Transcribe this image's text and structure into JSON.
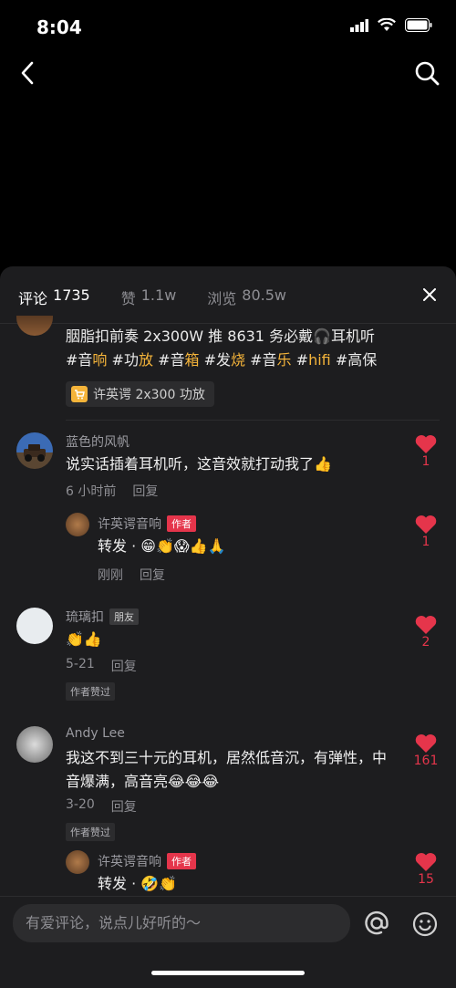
{
  "status": {
    "time": "8:04"
  },
  "header": {
    "tabs": [
      {
        "label": "评论",
        "count": "1735"
      },
      {
        "label": "赞",
        "count": "1.1w"
      },
      {
        "label": "浏览",
        "count": "80.5w"
      }
    ]
  },
  "post": {
    "line1": "胭脂扣前奏 2x300W 推 8631 务必戴🎧耳机听",
    "tags": [
      {
        "hash": "#音",
        "hl": "响"
      },
      {
        "hash": "#功",
        "hl": "放"
      },
      {
        "hash": "#音",
        "hl": "箱"
      },
      {
        "hash": "#发",
        "hl": "烧"
      },
      {
        "hash": "#音",
        "hl": "乐"
      },
      {
        "hash": "#",
        "hl": "hifi"
      },
      {
        "hash": "#高保",
        "hl": ""
      }
    ],
    "product": "许英谔 2x300 功放"
  },
  "comments": [
    {
      "name": "蓝色的风帆",
      "text": "说实话插着耳机听，这音效就打动我了👍",
      "time": "6 小时前",
      "reply": "回复",
      "likes": "1"
    },
    {
      "name": "许英谔音响",
      "badge": "作者",
      "text": "转发 · 😁👏😱👍🙏",
      "time": "刚刚",
      "reply": "回复",
      "likes": "1"
    },
    {
      "name": "琉璃扣",
      "badge": "朋友",
      "text": "👏👍",
      "time": "5-21",
      "reply": "回复",
      "tag": "作者赞过",
      "likes": "2"
    },
    {
      "name": "Andy Lee",
      "text": "我这不到三十元的耳机，居然低音沉，有弹性，中音爆满，高音亮😂😂😂",
      "time": "3-20",
      "reply": "回复",
      "tag": "作者赞过",
      "likes": "161"
    },
    {
      "name": "许英谔音响",
      "badge": "作者",
      "text": "转发 · 🤣👏",
      "likes": "15"
    }
  ],
  "input": {
    "placeholder": "有爱评论，说点儿好听的～"
  },
  "colors": {
    "accent": "#e5354b",
    "tag_highlight": "#f5b43a",
    "sheet_bg": "#1d1d1f"
  }
}
